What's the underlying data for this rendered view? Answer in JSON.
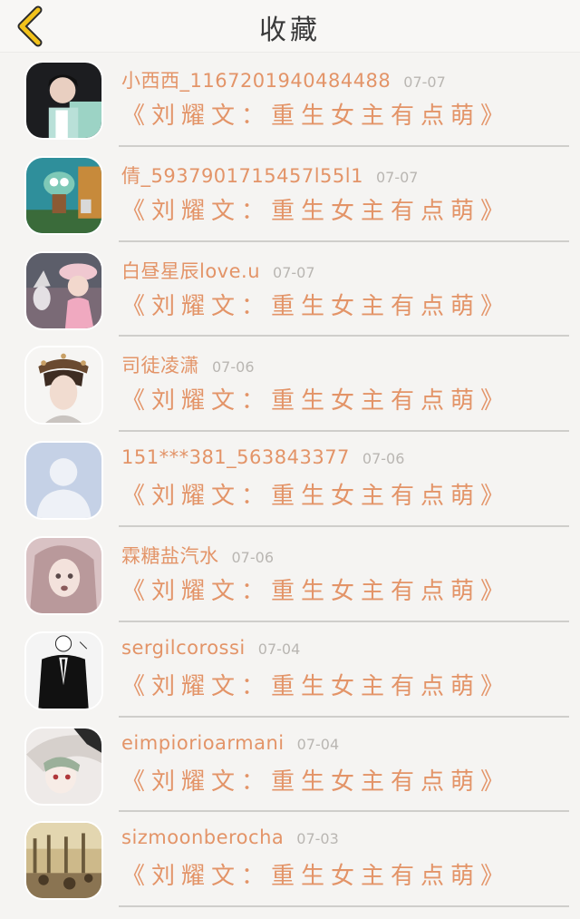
{
  "header": {
    "title": "收藏",
    "back_icon": "chevron-left-icon",
    "accent_color": "#f2c21b"
  },
  "items": [
    {
      "name": "小西西_1167201940484488",
      "date": "07-07",
      "quote": "《刘耀文：重生女主有点萌》"
    },
    {
      "name": "倩_5937901715457l55l1",
      "date": "07-07",
      "quote": "《刘耀文：重生女主有点萌》"
    },
    {
      "name": "白昼星辰love.u",
      "date": "07-07",
      "quote": "《刘耀文：重生女主有点萌》"
    },
    {
      "name": "司徒凌潇",
      "date": "07-06",
      "quote": "《刘耀文：重生女主有点萌》"
    },
    {
      "name": "151***381_563843377",
      "date": "07-06",
      "quote": "《刘耀文：重生女主有点萌》"
    },
    {
      "name": "霖糖盐汽水",
      "date": "07-06",
      "quote": "《刘耀文：重生女主有点萌》"
    },
    {
      "name": "sergilcorossi",
      "date": "07-04",
      "quote": "《刘耀文：重生女主有点萌》"
    },
    {
      "name": "eimpiorioarmani",
      "date": "07-04",
      "quote": "《刘耀文：重生女主有点萌》"
    },
    {
      "name": "sizmoonberocha",
      "date": "07-03",
      "quote": "《刘耀文：重生女主有点萌》"
    }
  ],
  "colors": {
    "name_text": "#e39468",
    "date_text": "#b9b6b2",
    "background": "#f5f4f2"
  }
}
